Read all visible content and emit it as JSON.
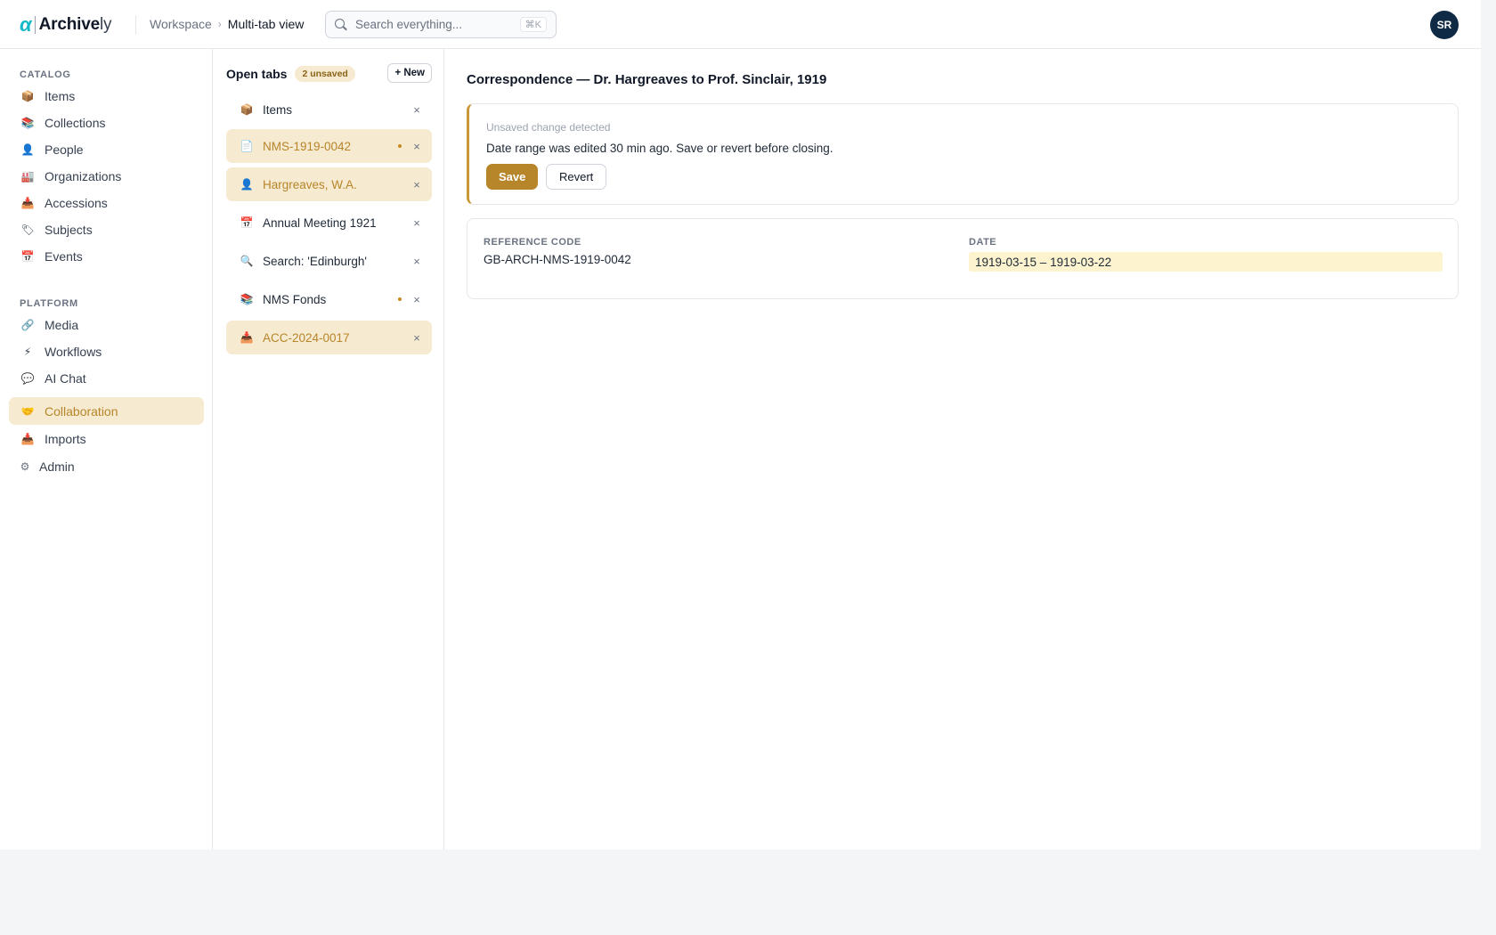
{
  "app": {
    "logo_mark": "α",
    "logo_name": "Archive",
    "logo_suffix": "ly"
  },
  "breadcrumb": {
    "root": "Workspace",
    "separator": "›",
    "current": "Multi-tab view"
  },
  "search": {
    "placeholder": "Search everything...",
    "shortcut": "⌘K"
  },
  "user": {
    "initials": "SR"
  },
  "sidebar": {
    "catalog_label": "CATALOG",
    "platform_label": "PLATFORM",
    "catalog_items": [
      {
        "label": "Items",
        "icon": "box-icon",
        "glyph": "📦"
      },
      {
        "label": "Collections",
        "icon": "books-icon",
        "glyph": "📚"
      },
      {
        "label": "People",
        "icon": "person-icon",
        "glyph": "👤"
      },
      {
        "label": "Organizations",
        "icon": "building-icon",
        "glyph": "🏭"
      },
      {
        "label": "Accessions",
        "icon": "inbox-tray-icon",
        "glyph": "📥"
      },
      {
        "label": "Subjects",
        "icon": "tag-icon",
        "glyph": "🏷"
      },
      {
        "label": "Events",
        "icon": "calendar-icon",
        "glyph": "📅"
      }
    ],
    "platform_items": [
      {
        "label": "Media",
        "icon": "link-icon",
        "glyph": "🔗"
      },
      {
        "label": "Workflows",
        "icon": "lightning-icon",
        "glyph": "⚡"
      },
      {
        "label": "AI Chat",
        "icon": "speech-bubble-icon",
        "glyph": "💬"
      },
      {
        "label": "Collaboration",
        "icon": "handshake-icon",
        "glyph": "🤝",
        "active": true
      },
      {
        "label": "Imports",
        "icon": "inbox-tray-icon",
        "glyph": "📥"
      },
      {
        "label": "Admin",
        "icon": "gear-icon",
        "glyph": "⚙"
      }
    ]
  },
  "tabs": {
    "title": "Open tabs",
    "unsaved_badge": "2 unsaved",
    "new_label": "+ New",
    "items": [
      {
        "label": "Items",
        "icon": "box-icon",
        "glyph": "📦",
        "highlighted": false,
        "unsaved": false
      },
      {
        "label": "NMS-1919-0042",
        "icon": "document-icon",
        "glyph": "📄",
        "highlighted": true,
        "unsaved": true
      },
      {
        "label": "Hargreaves, W.A.",
        "icon": "person-icon",
        "glyph": "👤",
        "highlighted": true,
        "unsaved": false
      },
      {
        "label": "Annual Meeting 1921",
        "icon": "calendar-icon",
        "glyph": "📅",
        "highlighted": false,
        "unsaved": false
      },
      {
        "label": "Search: 'Edinburgh'",
        "icon": "magnifier-icon",
        "glyph": "🔍",
        "highlighted": false,
        "unsaved": false
      },
      {
        "label": "NMS Fonds",
        "icon": "books-icon",
        "glyph": "📚",
        "highlighted": false,
        "unsaved": true
      },
      {
        "label": "ACC-2024-0017",
        "icon": "inbox-tray-icon",
        "glyph": "📥",
        "highlighted": true,
        "unsaved": false
      }
    ]
  },
  "main": {
    "title": "Correspondence — Dr. Hargreaves to Prof. Sinclair, 1919",
    "notice": {
      "title": "Unsaved change detected",
      "body": "Date range was edited 30 min ago. Save or revert before closing.",
      "save_label": "Save",
      "revert_label": "Revert"
    },
    "fields": {
      "reference_label": "REFERENCE CODE",
      "reference_value": "GB-ARCH-NMS-1919-0042",
      "date_label": "DATE",
      "date_value": "1919-03-15 – 1919-03-22"
    }
  },
  "colors": {
    "accent": "#b7852a",
    "accent_bg": "#f6ead0",
    "logo": "#14b8c8",
    "avatar": "#0f2a44",
    "date_highlight": "#fdf3cf"
  }
}
